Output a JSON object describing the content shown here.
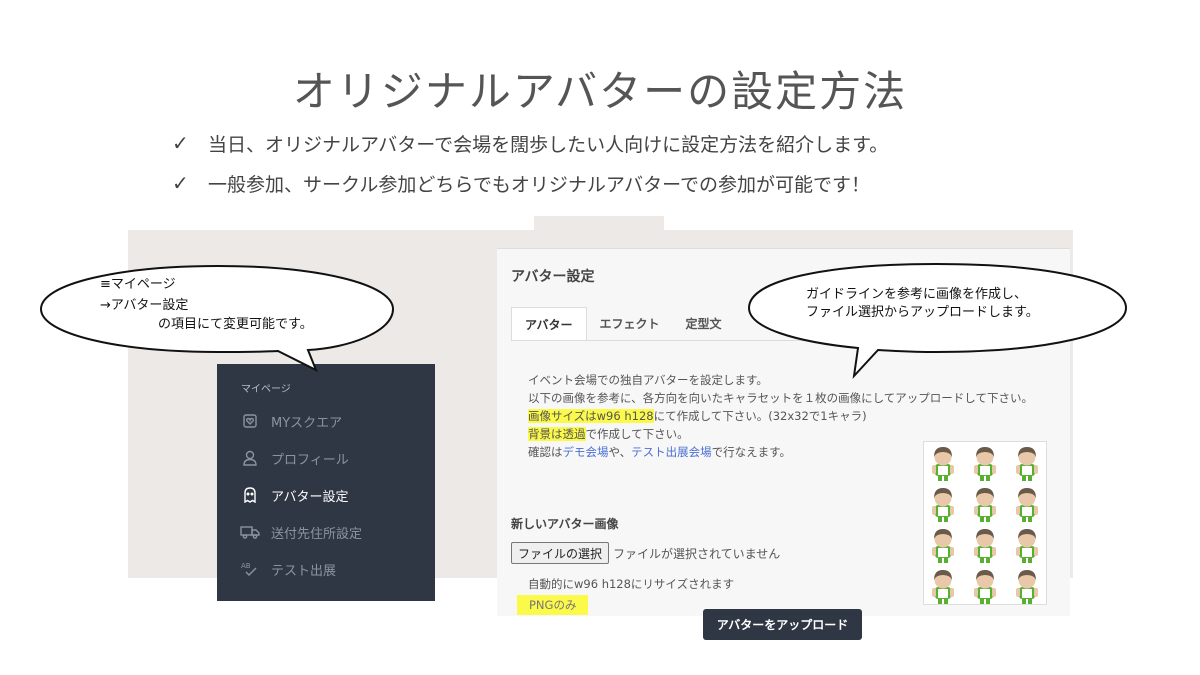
{
  "slide": {
    "title": "オリジナルアバターの設定方法",
    "bullets": [
      {
        "mark": "✓",
        "text": "当日、オリジナルアバターで会場を闊歩したい人向けに設定方法を紹介します。"
      },
      {
        "mark": "✓",
        "text": "一般参加、サークル参加どちらでもオリジナルアバターでの参加が可能です！"
      }
    ]
  },
  "sidebar": {
    "heading": "マイページ",
    "items": [
      {
        "label": "MYスクエア",
        "icon": "heart-frame-icon",
        "active": false
      },
      {
        "label": "プロフィール",
        "icon": "user-icon",
        "active": false
      },
      {
        "label": "アバター設定",
        "icon": "ghost-icon",
        "active": true
      },
      {
        "label": "送付先住所設定",
        "icon": "truck-icon",
        "active": false
      },
      {
        "label": "テスト出展",
        "icon": "ab-check-icon",
        "active": false
      }
    ]
  },
  "panel": {
    "title": "アバター設定",
    "tabs": [
      {
        "label": "アバター",
        "active": true
      },
      {
        "label": "エフェクト",
        "active": false
      },
      {
        "label": "定型文",
        "active": false
      }
    ],
    "description": {
      "line1": "イベント会場での独自アバターを設定します。",
      "line2": "以下の画像を参考に、各方向を向いたキャラセットを１枚の画像にしてアップロードして下さい。",
      "line3_highlight": "画像サイズはw96 h128",
      "line3_rest": "にて作成して下さい。(32x32で1キャラ)",
      "line4_highlight": "背景は透過",
      "line4_rest": "で作成して下さい。",
      "line5_prefix": "確認は",
      "line5_link1": "デモ会場",
      "line5_mid": "や、",
      "line5_link2": "テスト出展会場",
      "line5_suffix": "で行なえます。"
    },
    "new_avatar_label": "新しいアバター画像",
    "file_button": "ファイルの選択",
    "file_status": "ファイルが選択されていません",
    "resize_note": "自動的にw96 h128にリサイズされます",
    "png_note": "PNGのみ",
    "upload_button": "アバターをアップロード"
  },
  "bubbles": {
    "left": {
      "line1": "≡マイページ",
      "line2": "→アバター設定",
      "line3": "の項目にて変更可能です。"
    },
    "right": {
      "line1": "ガイドラインを参考に画像を作成し、",
      "line2": "ファイル選択からアップロードします。"
    }
  },
  "colors": {
    "sidebar_bg": "#2f3744",
    "highlight": "#fbf94a",
    "link": "#4a6fd4",
    "sprite_shirt": "#58b030",
    "sprite_hair": "#6a5a4a"
  }
}
